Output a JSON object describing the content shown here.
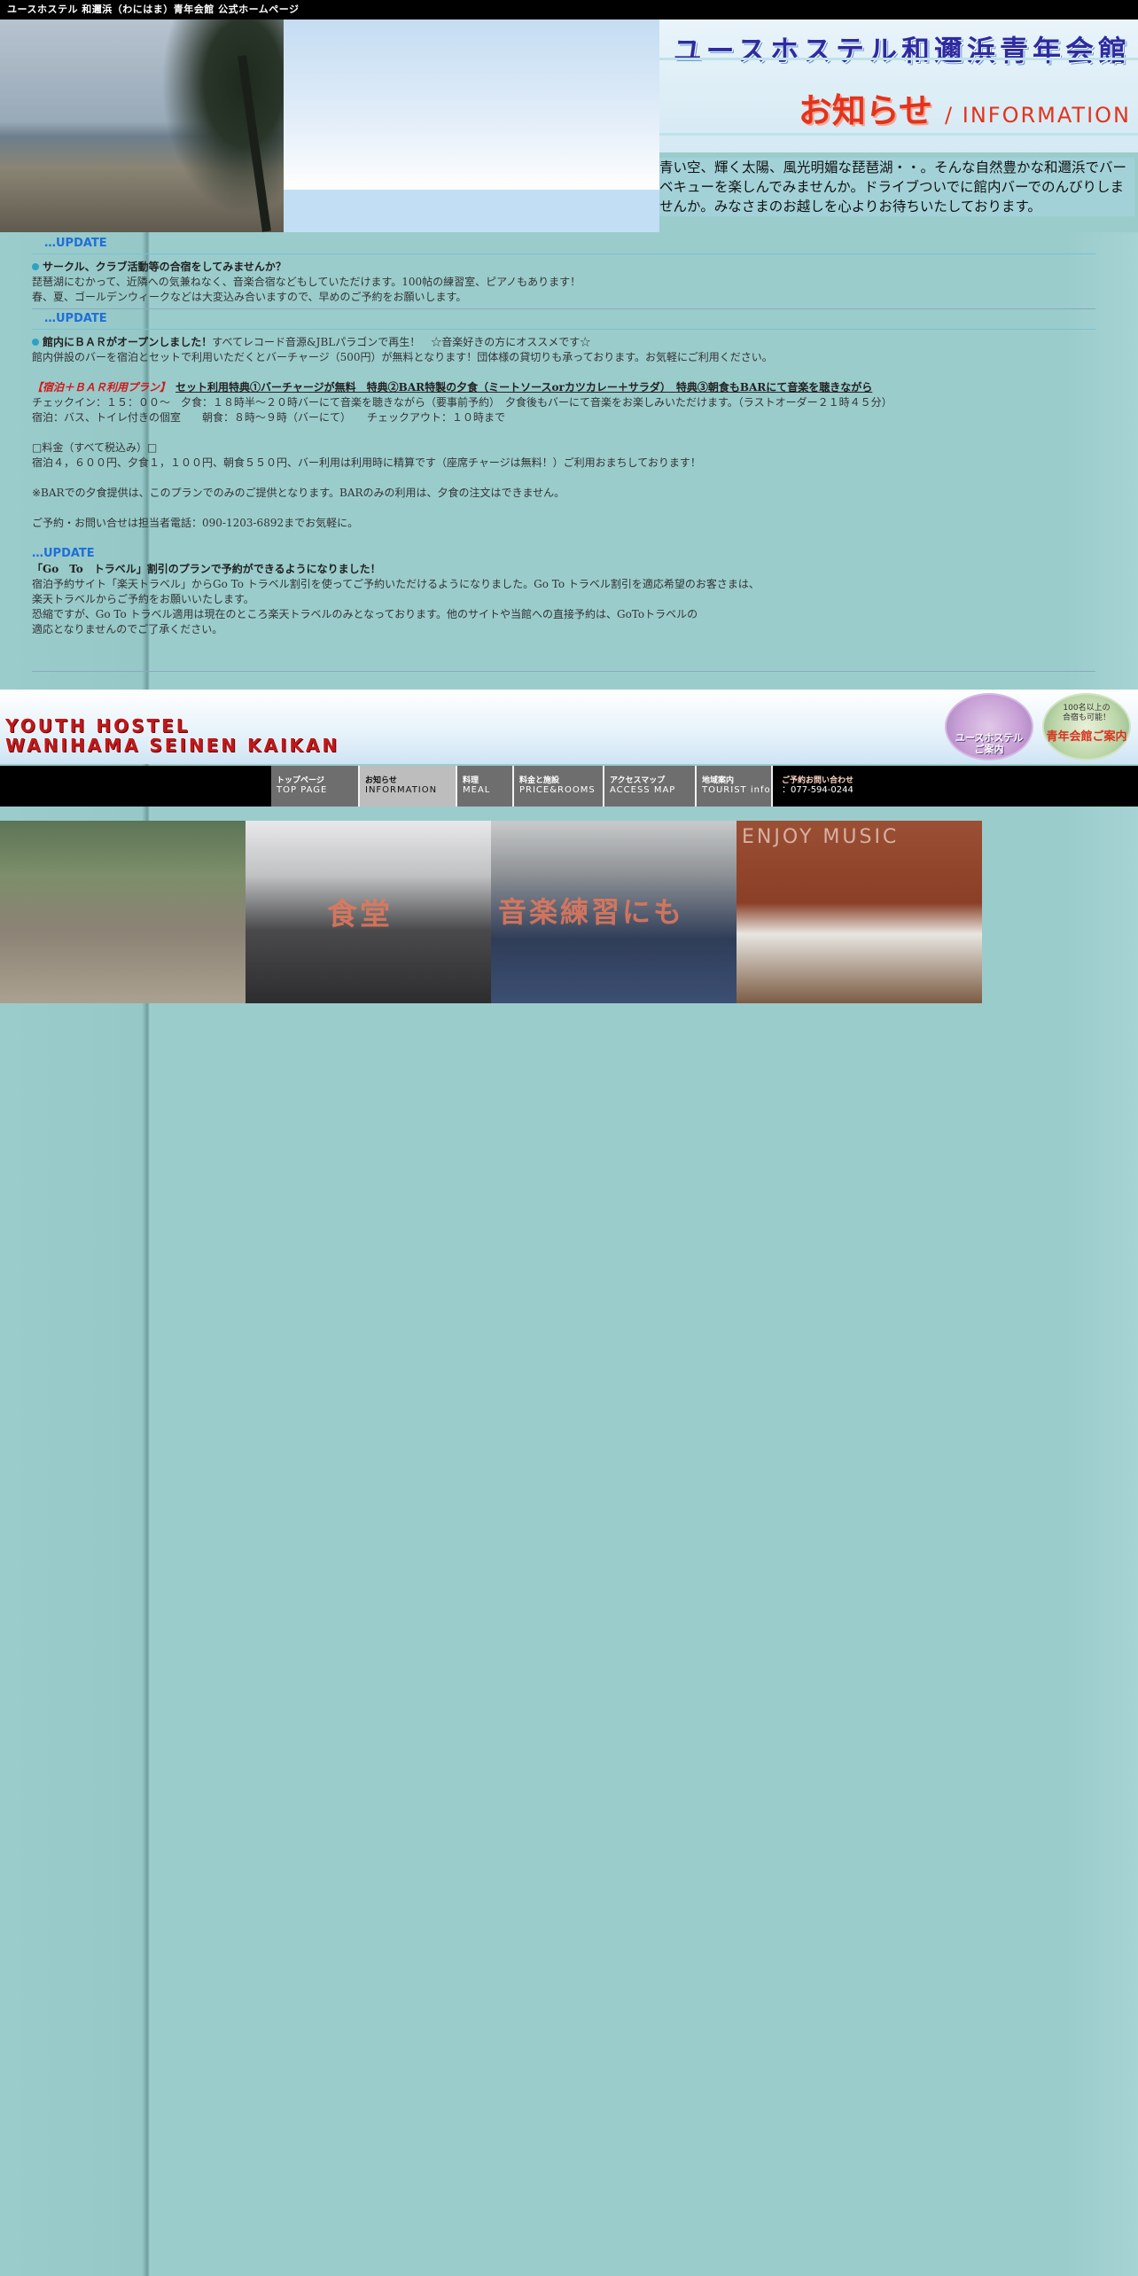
{
  "topbar": {
    "title": "ユースホステル 和邇浜（わにはま）青年会館 公式ホームページ"
  },
  "header": {
    "site_title": "ユースホステル和邇浜青年会館",
    "section_title_jp": "お知らせ",
    "section_title_en": "/ INFORMATION",
    "intro": "青い空、輝く太陽、風光明媚な琵琶湖・・。そんな自然豊かな和邇浜でバーベキューを楽しんでみませんか。ドライブついでに館内バーでのんびりしませんか。みなさまのお越しを心よりお待ちいたしております。"
  },
  "update_label": "…UPDATE",
  "notices": {
    "circle": {
      "heading": "サークル、クラブ活動等の合宿をしてみませんか？",
      "line1": "琵琶湖にむかって、近隣への気兼ねなく、音楽合宿などもしていただけます。100帖の練習室、ピアノもあります！",
      "line2": "春、夏、ゴールデンウィークなどは大変込み合いますので、早めのご予約をお願いします。"
    },
    "bar": {
      "heading": "館内にＢＡＲがオープンしました！",
      "heading_tail": "すべてレコード音源&JBLパラゴンで再生！　☆音楽好きの方にオススメです☆",
      "line1": "館内併設のバーを宿泊とセットで利用いただくとバーチャージ（500円）が無料となります！団体様の貸切りも承っております。お気軽にご利用ください。",
      "plan_label": "【宿泊＋ＢＡＲ利用プラン】",
      "plan_text": "セット利用特典①バーチャージが無料　特典②BAR特製の夕食（ミートソースorカツカレー＋サラダ）　特典③朝食もBARにて音楽を聴きながら",
      "checkin": "チェックイン：１５：００～　夕食：１８時半～２０時バーにて音楽を聴きながら（要事前予約）　夕食後もバーにて音楽をお楽しみいただけます。（ラストオーダー２１時４５分）",
      "lodging": "宿泊：バス、トイレ付きの個室　　朝食：８時～９時（バーにて）　　チェックアウト：１０時まで",
      "price_label": "□料金（すべて税込み）□",
      "price": "宿泊４，６００円、夕食１，１００円、朝食５５０円、バー利用は利用時に精算です（座席チャージは無料！）ご利用おまちしております！",
      "note": "※BARでの夕食提供は、このプランでのみのご提供となります。BARのみの利用は、夕食の注文はできません。",
      "contact": "ご予約・お問い合せは担当者電話：090-1203-6892までお気軽に。"
    },
    "goto": {
      "heading": "「Go　To　トラベル」割引のプランで予約ができるようになりました！",
      "line1": "宿泊予約サイト「楽天トラベル」からGo To トラベル割引を使ってご予約いただけるようになりました。Go To トラベル割引を適応希望のお客さまは、",
      "line2": "楽天トラベルからご予約をお願いいたします。",
      "line3": "恐縮ですが、Go To トラベル適用は現在のところ楽天トラベルのみとなっております。他のサイトや当館への直接予約は、GoToトラベルの",
      "line4": "適応となりませんのでご了承ください。"
    }
  },
  "banner": {
    "line1": "YOUTH HOSTEL",
    "line2": "WANIHAMA SEINEN KAIKAN",
    "yh_badge": "ユースホステル\nご案内",
    "hall_badge_small": "100名以上の\n合宿も可能！",
    "hall_badge": "青年会館ご案内"
  },
  "nav": {
    "items": [
      {
        "jp": "トップページ",
        "en": "TOP PAGE"
      },
      {
        "jp": "お知らせ",
        "en": "INFORMATION"
      },
      {
        "jp": "料理",
        "en": "MEAL"
      },
      {
        "jp": "料金と施設",
        "en": "PRICE&ROOMS"
      },
      {
        "jp": "アクセスマップ",
        "en": "ACCESS MAP"
      },
      {
        "jp": "地域案内",
        "en": "TOURIST info"
      }
    ],
    "contact_jp": "ご予約お問い合わせ",
    "contact_tel": "：077-594-0244"
  },
  "photos": {
    "p2_label": "食堂",
    "p3_label": "音楽練習にも",
    "p4_label": "ENJOY MUSIC"
  },
  "colors": {
    "background": "#9bcccc",
    "update": "#1f6fd8",
    "plan_red": "#d01818",
    "nav_gray": "#6e6e6e"
  }
}
